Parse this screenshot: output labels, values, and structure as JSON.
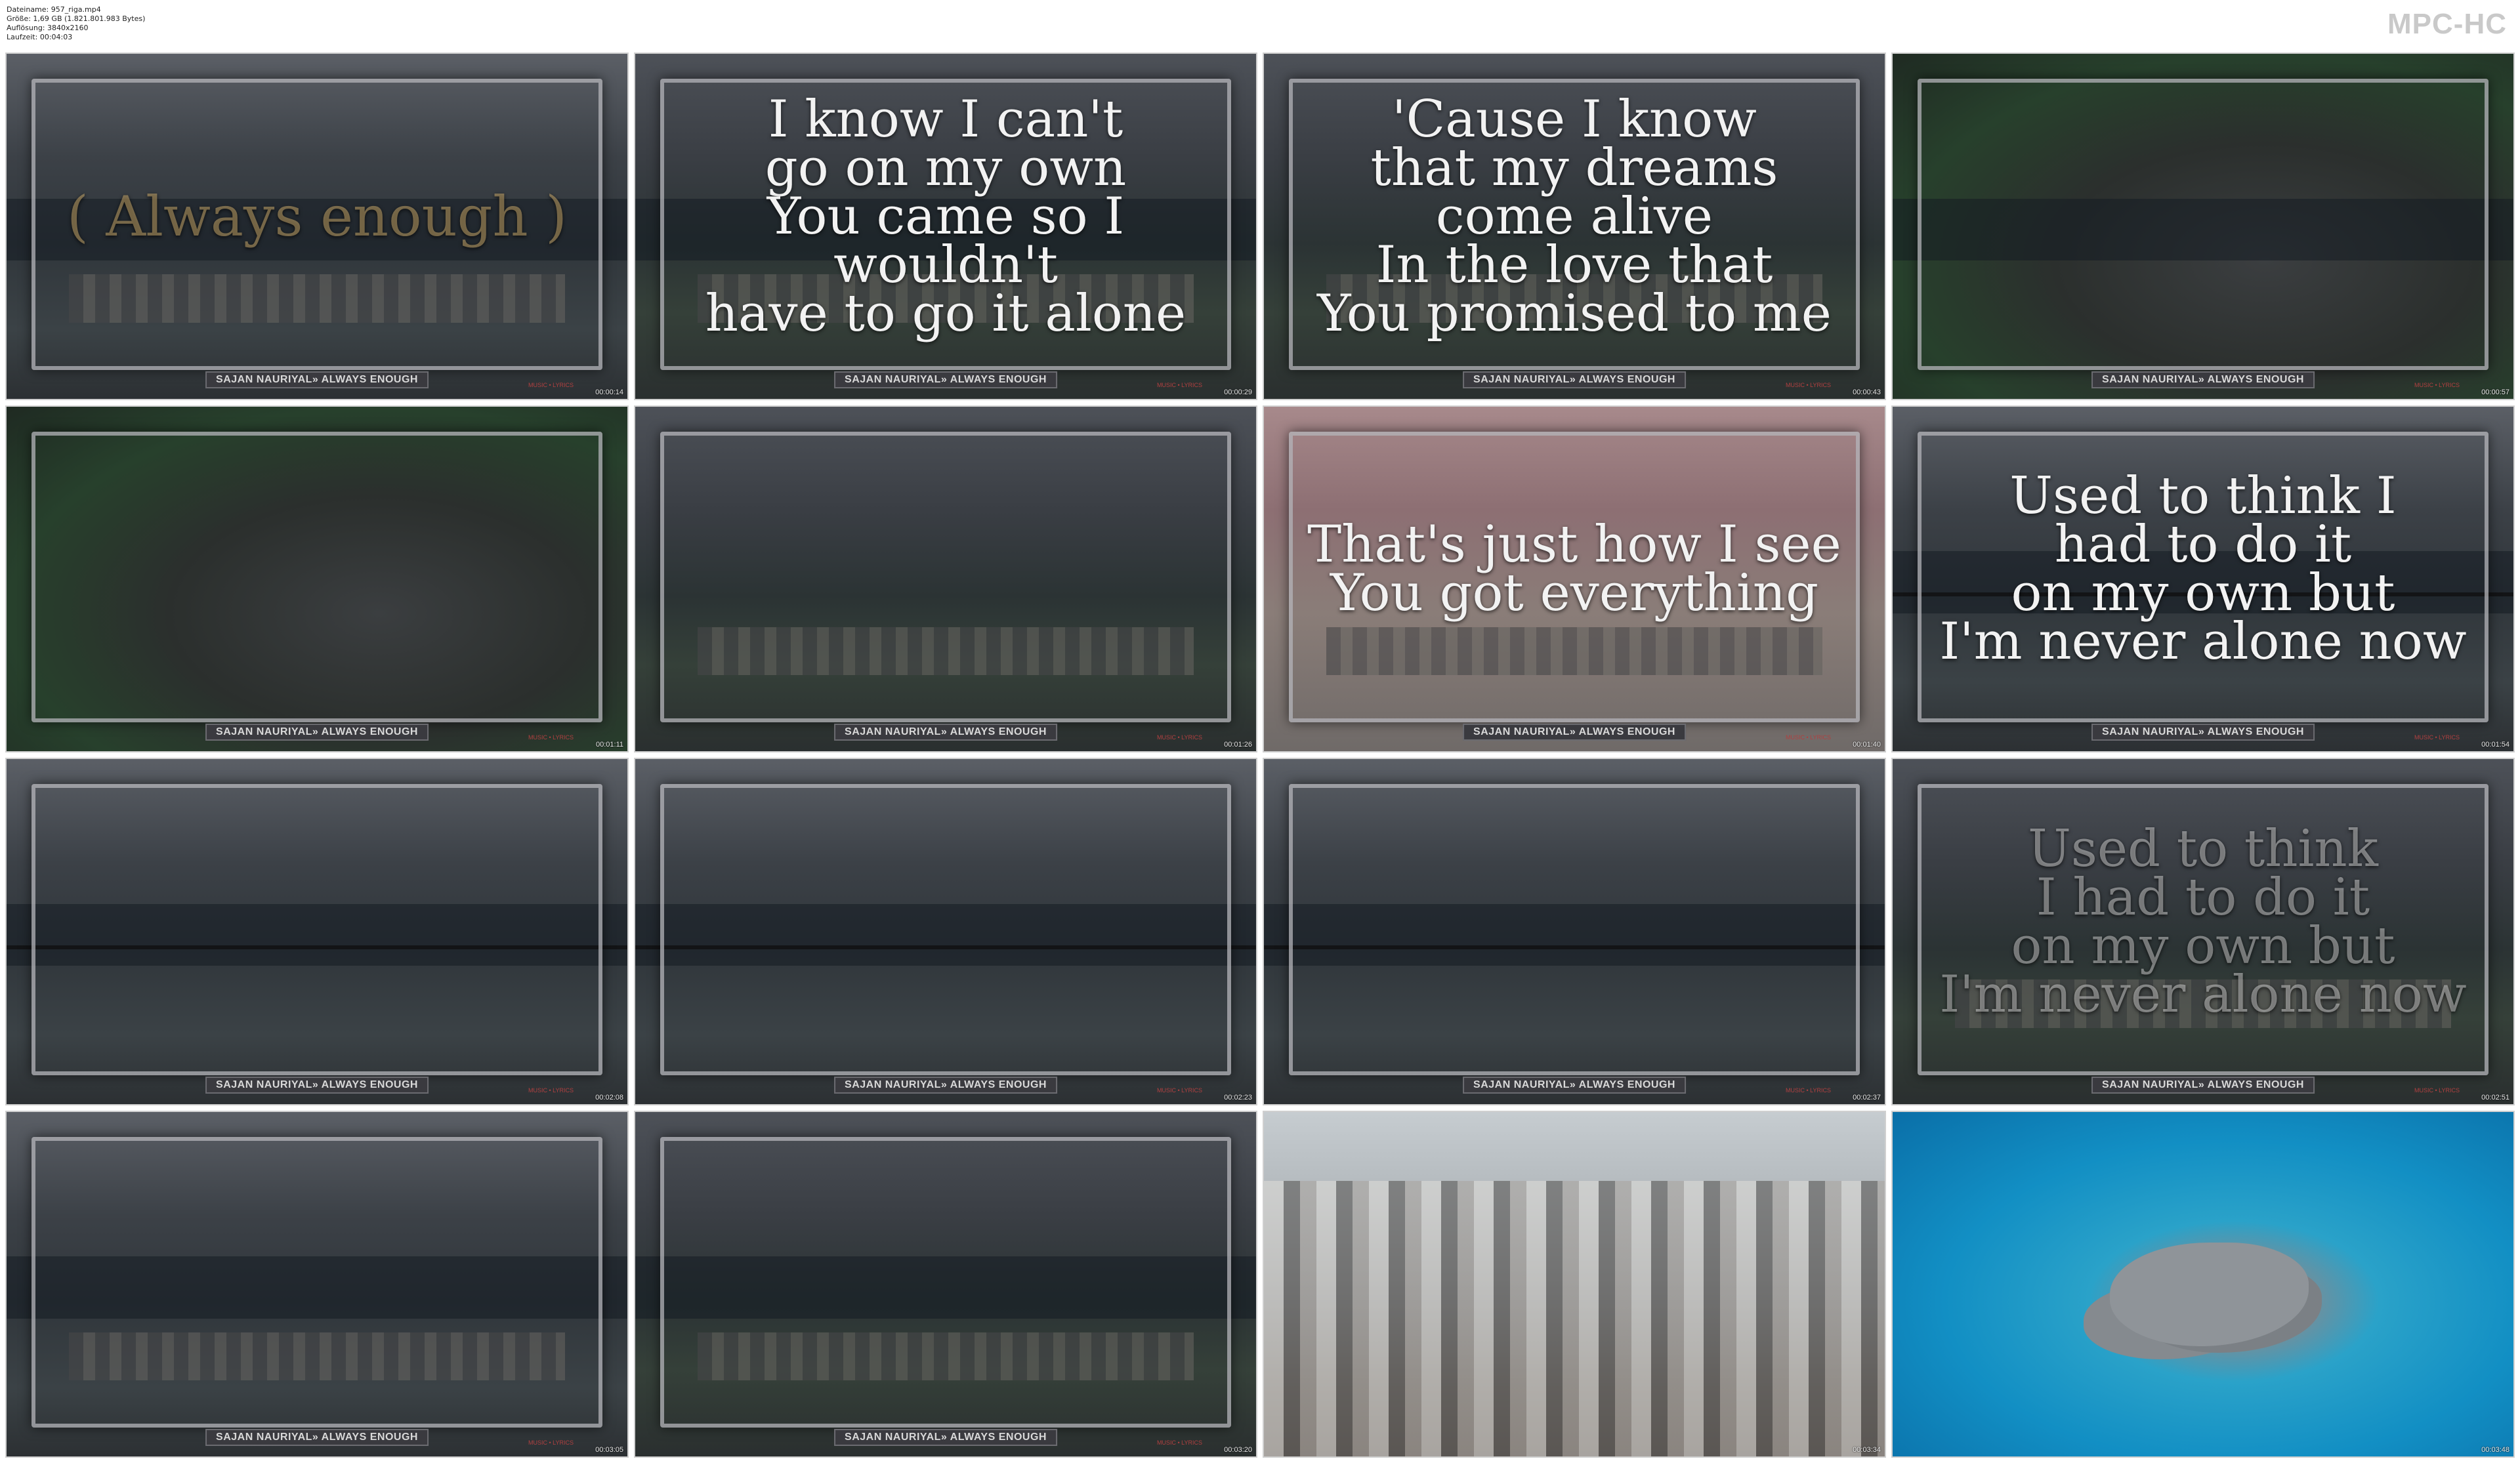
{
  "header": {
    "info_lines": [
      "Dateiname: 957_riga.mp4",
      "Größe: 1,69 GB (1.821.801.983 Bytes)",
      "Auflösung: 3840x2160",
      "Laufzeit: 00:04:03"
    ],
    "brand": "MPC-HC"
  },
  "caption": "SAJAN NAURIYAL» ALWAYS ENOUGH",
  "tag": "MUSIC • LYRICS",
  "thumbnails": [
    {
      "time": "00:00:14",
      "lyric": "( Always enough )"
    },
    {
      "time": "00:00:29",
      "lyric": "I know I can't\ngo on my own\nYou came so I wouldn't\nhave to go it alone"
    },
    {
      "time": "00:00:43",
      "lyric": "'Cause I know\nthat my dreams\ncome alive\nIn the love that\nYou promised to me"
    },
    {
      "time": "00:00:57",
      "lyric": ""
    },
    {
      "time": "00:01:11",
      "lyric": ""
    },
    {
      "time": "00:01:26",
      "lyric": ""
    },
    {
      "time": "00:01:40",
      "lyric": "That's just how I see\nYou got everything"
    },
    {
      "time": "00:01:54",
      "lyric": "Used to think I\nhad to do it\non my own but\nI'm never alone now"
    },
    {
      "time": "00:02:08",
      "lyric": ""
    },
    {
      "time": "00:02:23",
      "lyric": ""
    },
    {
      "time": "00:02:37",
      "lyric": ""
    },
    {
      "time": "00:02:51",
      "lyric": "Used to think\nI had to do it\non my own but\nI'm never alone now"
    },
    {
      "time": "00:03:05",
      "lyric": ""
    },
    {
      "time": "00:03:20",
      "lyric": ""
    },
    {
      "time": "00:03:34",
      "lyric": ""
    },
    {
      "time": "00:03:48",
      "lyric": ""
    }
  ]
}
